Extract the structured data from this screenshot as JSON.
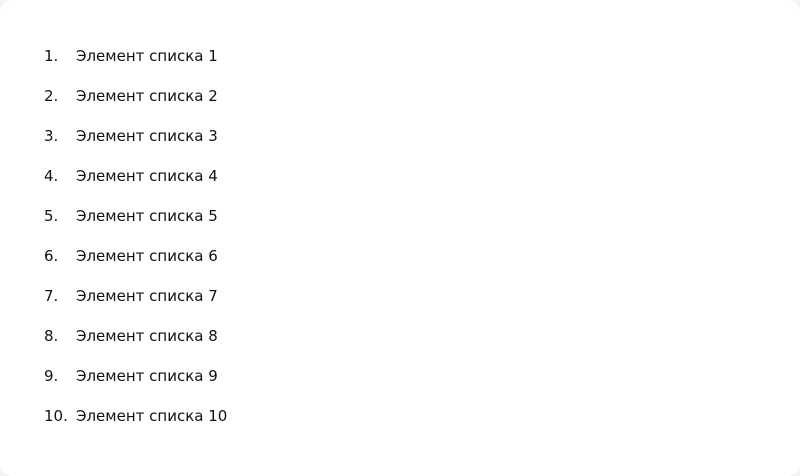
{
  "list": {
    "items": [
      {
        "number": "1.",
        "label": "Элемент списка 1"
      },
      {
        "number": "2.",
        "label": "Элемент списка 2"
      },
      {
        "number": "3.",
        "label": "Элемент списка 3"
      },
      {
        "number": "4.",
        "label": "Элемент списка 4"
      },
      {
        "number": "5.",
        "label": "Элемент списка 5"
      },
      {
        "number": "6.",
        "label": "Элемент списка 6"
      },
      {
        "number": "7.",
        "label": "Элемент списка 7"
      },
      {
        "number": "8.",
        "label": "Элемент списка 8"
      },
      {
        "number": "9.",
        "label": "Элемент списка 9"
      },
      {
        "number": "10.",
        "label": "Элемент списка 10"
      }
    ]
  }
}
